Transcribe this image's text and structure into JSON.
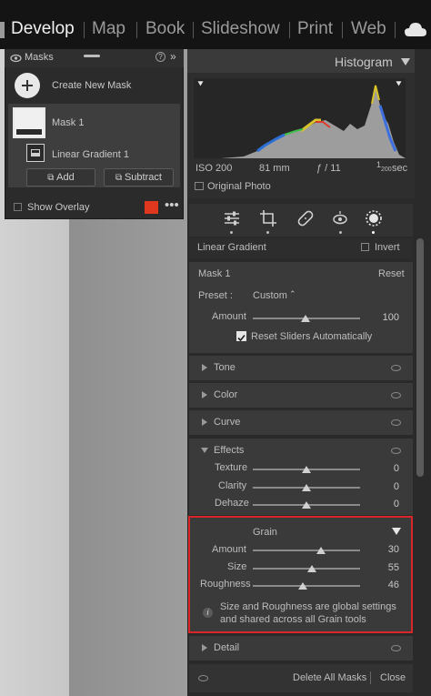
{
  "modules": [
    "Develop",
    "Map",
    "Book",
    "Slideshow",
    "Print",
    "Web"
  ],
  "masks_panel": {
    "title": "Masks",
    "create_new": "Create New Mask",
    "mask_name": "Mask 1",
    "component_name": "Linear Gradient 1",
    "add_label": "Add",
    "subtract_label": "Subtract",
    "show_overlay": "Show Overlay",
    "overlay_color": "#e0371f"
  },
  "histogram": {
    "title": "Histogram",
    "iso": "ISO 200",
    "focal": "81 mm",
    "aperture": "ƒ / 11",
    "shutter_num": "1",
    "shutter_den": "200",
    "shutter_unit": "sec",
    "original_photo": "Original Photo"
  },
  "panel": {
    "linear_gradient": "Linear Gradient",
    "invert": "Invert",
    "mask_label": "Mask 1",
    "reset": "Reset",
    "preset_label": "Preset :",
    "preset_value": "Custom",
    "amount_label": "Amount",
    "amount_value": "100",
    "reset_sliders": "Reset Sliders Automatically",
    "tone": "Tone",
    "color": "Color",
    "curve": "Curve",
    "effects": "Effects",
    "texture_label": "Texture",
    "texture_value": "0",
    "clarity_label": "Clarity",
    "clarity_value": "0",
    "dehaze_label": "Dehaze",
    "dehaze_value": "0",
    "grain_title": "Grain",
    "grain_amount_label": "Amount",
    "grain_amount_value": "30",
    "grain_size_label": "Size",
    "grain_size_value": "55",
    "grain_rough_label": "Roughness",
    "grain_rough_value": "46",
    "grain_info": "Size and Roughness are global settings and shared across all Grain tools",
    "detail": "Detail",
    "delete_all": "Delete All Masks",
    "close": "Close"
  },
  "colors": {
    "highlight_border": "#d8262a",
    "panel_bg": "#3a3a3a"
  },
  "slider_levels": {
    "amount": 0.5,
    "texture": 0.5,
    "clarity": 0.5,
    "dehaze": 0.5,
    "grain_amount": 0.65,
    "grain_size": 0.55,
    "grain_roughness": 0.46
  }
}
